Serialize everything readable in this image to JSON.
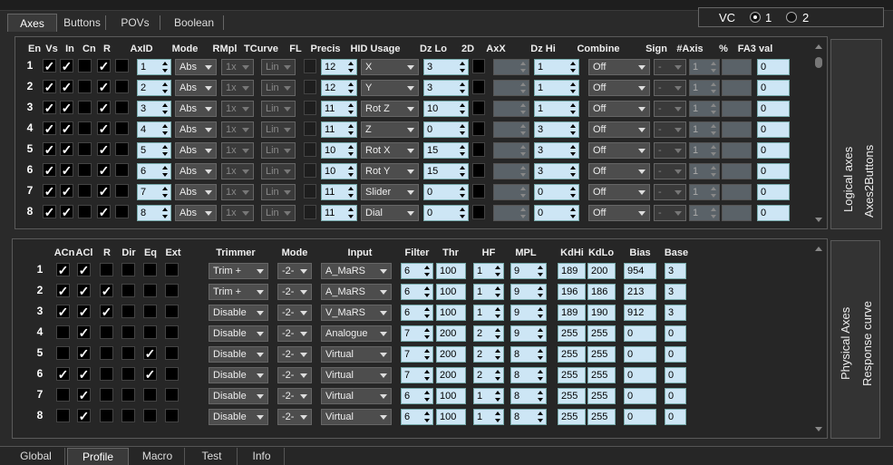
{
  "top_tabs": [
    {
      "label": "Axes",
      "active": true
    },
    {
      "label": "Buttons",
      "active": false
    },
    {
      "label": "POVs",
      "active": false
    },
    {
      "label": "Boolean",
      "active": false
    }
  ],
  "vc": {
    "label": "VC",
    "options": [
      "1",
      "2"
    ],
    "selected": "1"
  },
  "logical": {
    "headers": [
      "En",
      "Vs",
      "In",
      "Cn",
      "R",
      "AxID",
      "Mode",
      "RMpl",
      "TCurve",
      "FL",
      "Precis",
      "HID Usage",
      "Dz Lo",
      "2D",
      "AxX",
      "Dz Hi",
      "Combine",
      "Sign",
      "#Axis",
      "%",
      "FA3 val"
    ],
    "side_labels": [
      "Logical axes",
      "Axes2Buttons"
    ],
    "rows": [
      {
        "num": "1",
        "en": true,
        "vs": true,
        "in": false,
        "cn": true,
        "r": false,
        "axid": "1",
        "mode": "Abs",
        "rmpl": "1x",
        "tcurve": "Lin",
        "precis": "12",
        "hid": "X",
        "dzlo": "3",
        "dzhi": "1",
        "combine": "Off",
        "sign": "-",
        "naxis": "1",
        "fa3": "0"
      },
      {
        "num": "2",
        "en": true,
        "vs": true,
        "in": false,
        "cn": true,
        "r": false,
        "axid": "2",
        "mode": "Abs",
        "rmpl": "1x",
        "tcurve": "Lin",
        "precis": "12",
        "hid": "Y",
        "dzlo": "3",
        "dzhi": "1",
        "combine": "Off",
        "sign": "-",
        "naxis": "1",
        "fa3": "0"
      },
      {
        "num": "3",
        "en": true,
        "vs": true,
        "in": false,
        "cn": true,
        "r": false,
        "axid": "3",
        "mode": "Abs",
        "rmpl": "1x",
        "tcurve": "Lin",
        "precis": "11",
        "hid": "Rot Z",
        "dzlo": "10",
        "dzhi": "1",
        "combine": "Off",
        "sign": "-",
        "naxis": "1",
        "fa3": "0"
      },
      {
        "num": "4",
        "en": true,
        "vs": true,
        "in": false,
        "cn": true,
        "r": false,
        "axid": "4",
        "mode": "Abs",
        "rmpl": "1x",
        "tcurve": "Lin",
        "precis": "11",
        "hid": "Z",
        "dzlo": "0",
        "dzhi": "3",
        "combine": "Off",
        "sign": "-",
        "naxis": "1",
        "fa3": "0"
      },
      {
        "num": "5",
        "en": true,
        "vs": true,
        "in": false,
        "cn": true,
        "r": false,
        "axid": "5",
        "mode": "Abs",
        "rmpl": "1x",
        "tcurve": "Lin",
        "precis": "10",
        "hid": "Rot X",
        "dzlo": "15",
        "dzhi": "3",
        "combine": "Off",
        "sign": "-",
        "naxis": "1",
        "fa3": "0"
      },
      {
        "num": "6",
        "en": true,
        "vs": true,
        "in": false,
        "cn": true,
        "r": false,
        "axid": "6",
        "mode": "Abs",
        "rmpl": "1x",
        "tcurve": "Lin",
        "precis": "10",
        "hid": "Rot Y",
        "dzlo": "15",
        "dzhi": "3",
        "combine": "Off",
        "sign": "-",
        "naxis": "1",
        "fa3": "0"
      },
      {
        "num": "7",
        "en": true,
        "vs": true,
        "in": false,
        "cn": true,
        "r": false,
        "axid": "7",
        "mode": "Abs",
        "rmpl": "1x",
        "tcurve": "Lin",
        "precis": "11",
        "hid": "Slider",
        "dzlo": "0",
        "dzhi": "0",
        "combine": "Off",
        "sign": "-",
        "naxis": "1",
        "fa3": "0"
      },
      {
        "num": "8",
        "en": true,
        "vs": true,
        "in": false,
        "cn": true,
        "r": false,
        "axid": "8",
        "mode": "Abs",
        "rmpl": "1x",
        "tcurve": "Lin",
        "precis": "11",
        "hid": "Dial",
        "dzlo": "0",
        "dzhi": "0",
        "combine": "Off",
        "sign": "-",
        "naxis": "1",
        "fa3": "0"
      }
    ]
  },
  "physical": {
    "headers": [
      "ACn",
      "ACl",
      "R",
      "Dir",
      "Eq",
      "Ext",
      "Trimmer",
      "Mode",
      "Input",
      "Filter",
      "Thr",
      "HF",
      "MPL",
      "KdHi",
      "KdLo",
      "Bias",
      "Base"
    ],
    "side_labels": [
      "Physical Axes",
      "Response curve"
    ],
    "rows": [
      {
        "num": "1",
        "acn": true,
        "acl": true,
        "r": false,
        "dir": false,
        "eq": false,
        "ext": false,
        "trimmer": "Trim +",
        "mode": "-2-",
        "input": "A_MaRS",
        "filter": "6",
        "thr": "100",
        "hf": "1",
        "mpl": "9",
        "kdhi": "189",
        "kdlo": "200",
        "bias": "954",
        "base": "3"
      },
      {
        "num": "2",
        "acn": true,
        "acl": true,
        "r": true,
        "dir": false,
        "eq": false,
        "ext": false,
        "trimmer": "Trim +",
        "mode": "-2-",
        "input": "A_MaRS",
        "filter": "6",
        "thr": "100",
        "hf": "1",
        "mpl": "9",
        "kdhi": "196",
        "kdlo": "186",
        "bias": "213",
        "base": "3"
      },
      {
        "num": "3",
        "acn": true,
        "acl": true,
        "r": true,
        "dir": false,
        "eq": false,
        "ext": false,
        "trimmer": "Disable",
        "mode": "-2-",
        "input": "V_MaRS",
        "filter": "6",
        "thr": "100",
        "hf": "1",
        "mpl": "9",
        "kdhi": "189",
        "kdlo": "190",
        "bias": "912",
        "base": "3"
      },
      {
        "num": "4",
        "acn": false,
        "acl": true,
        "r": false,
        "dir": false,
        "eq": false,
        "ext": false,
        "trimmer": "Disable",
        "mode": "-2-",
        "input": "Analogue",
        "filter": "7",
        "thr": "200",
        "hf": "2",
        "mpl": "9",
        "kdhi": "255",
        "kdlo": "255",
        "bias": "0",
        "base": "0"
      },
      {
        "num": "5",
        "acn": false,
        "acl": true,
        "r": false,
        "dir": false,
        "eq": true,
        "ext": false,
        "trimmer": "Disable",
        "mode": "-2-",
        "input": "Virtual",
        "filter": "7",
        "thr": "200",
        "hf": "2",
        "mpl": "8",
        "kdhi": "255",
        "kdlo": "255",
        "bias": "0",
        "base": "0"
      },
      {
        "num": "6",
        "acn": true,
        "acl": true,
        "r": false,
        "dir": false,
        "eq": true,
        "ext": false,
        "trimmer": "Disable",
        "mode": "-2-",
        "input": "Virtual",
        "filter": "7",
        "thr": "200",
        "hf": "2",
        "mpl": "8",
        "kdhi": "255",
        "kdlo": "255",
        "bias": "0",
        "base": "0"
      },
      {
        "num": "7",
        "acn": false,
        "acl": true,
        "r": false,
        "dir": false,
        "eq": false,
        "ext": false,
        "trimmer": "Disable",
        "mode": "-2-",
        "input": "Virtual",
        "filter": "6",
        "thr": "100",
        "hf": "1",
        "mpl": "8",
        "kdhi": "255",
        "kdlo": "255",
        "bias": "0",
        "base": "0"
      },
      {
        "num": "8",
        "acn": false,
        "acl": true,
        "r": false,
        "dir": false,
        "eq": false,
        "ext": false,
        "trimmer": "Disable",
        "mode": "-2-",
        "input": "Virtual",
        "filter": "6",
        "thr": "100",
        "hf": "1",
        "mpl": "8",
        "kdhi": "255",
        "kdlo": "255",
        "bias": "0",
        "base": "0"
      }
    ]
  },
  "bottom_tabs": [
    {
      "label": "Global",
      "active": false
    },
    {
      "label": "Profile",
      "active": true
    },
    {
      "label": "Macro",
      "active": false
    },
    {
      "label": "Test",
      "active": false
    },
    {
      "label": "Info",
      "active": false
    }
  ]
}
